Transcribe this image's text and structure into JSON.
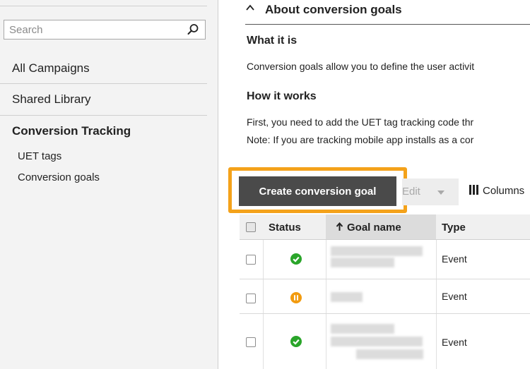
{
  "sidebar": {
    "search_placeholder": "Search",
    "nav": {
      "all_campaigns": "All Campaigns",
      "shared_library": "Shared Library",
      "section": "Conversion Tracking",
      "sub_items": [
        "UET tags",
        "Conversion goals"
      ]
    }
  },
  "about": {
    "title": "About conversion goals",
    "what_heading": "What it is",
    "what_text": "Conversion goals allow you to define the user activit",
    "how_heading": "How it works",
    "how_text_1": "First, you need to add the UET tag tracking code thr",
    "how_text_2": "Note: If you are tracking mobile app installs as a cor"
  },
  "toolbar": {
    "create_label": "Create conversion goal",
    "edit_label": "Edit",
    "columns_label": "Columns"
  },
  "table": {
    "headers": {
      "status": "Status",
      "goal_name": "Goal name",
      "type": "Type"
    },
    "rows": [
      {
        "status": "active",
        "type": "Event"
      },
      {
        "status": "paused",
        "type": "Event"
      },
      {
        "status": "active",
        "type": "Event"
      }
    ]
  },
  "colors": {
    "highlight": "#f4a21a",
    "active_status": "#2aa52a",
    "paused_status": "#f29b0f",
    "primary_button": "#4a4a4a"
  },
  "icons": {
    "search": "search-icon",
    "collapse": "chevron-up-icon",
    "sort": "arrow-up-icon",
    "columns": "columns-icon",
    "active": "check-circle-icon",
    "paused": "pause-circle-icon"
  }
}
